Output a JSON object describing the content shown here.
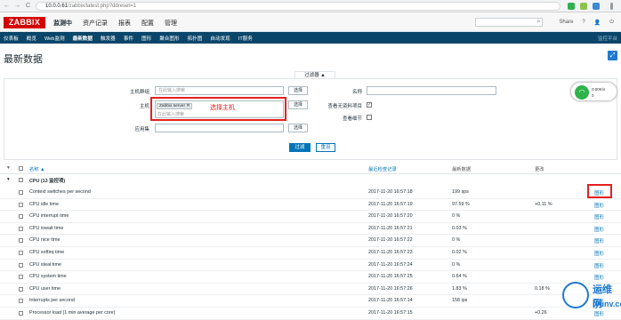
{
  "browser": {
    "back": "←",
    "forward": "→",
    "reload": "C",
    "url_host": "10.0.0.61",
    "url_path": "/zabbix/latest.php?ddreset=1"
  },
  "header": {
    "logo": "ZABBIX",
    "menu": [
      "监测中",
      "资产记录",
      "报表",
      "配置",
      "管理"
    ],
    "right": {
      "share": "Share",
      "help": "?",
      "user": "👤",
      "logout": "⏻"
    }
  },
  "subnav": {
    "items": [
      "仪表板",
      "概览",
      "Web监测",
      "最新数据",
      "触发器",
      "事件",
      "图形",
      "聚合图形",
      "拓扑图",
      "自动发现",
      "IT服务"
    ],
    "right": "监控平台"
  },
  "page": {
    "title": "最新数据"
  },
  "filter": {
    "tab_label": "过滤器 ▲",
    "host_group_label": "主机群组",
    "host_group_placeholder": "在此输入搜索",
    "host_label": "主机",
    "host_tag": "Zabbix server",
    "host_placeholder": "在此输入搜索",
    "app_label": "应用集",
    "select": "选择",
    "name_label": "名称",
    "show_no_data_label": "查看无资料项目",
    "show_details_label": "查看细节",
    "annotation": "选择主机",
    "apply": "过滤",
    "reset": "重设"
  },
  "widget": {
    "line1": "0.00K/s",
    "line2": "0"
  },
  "table": {
    "headers": {
      "name": "名称 ▲",
      "last_check": "最近检查记录",
      "last_value": "最新数据",
      "change": "更改"
    },
    "group": "CPU (13 监控项)",
    "graph_label": "图形",
    "rows": [
      {
        "name": "Context switches per second",
        "time": "2017-11-20 16:57:18",
        "value": "199 sps",
        "change": ""
      },
      {
        "name": "CPU idle time",
        "time": "2017-11-20 16:57:19",
        "value": "97.59 %",
        "change": "+0.11 %"
      },
      {
        "name": "CPU interrupt time",
        "time": "2017-11-20 16:57:20",
        "value": "0 %",
        "change": ""
      },
      {
        "name": "CPU iowait time",
        "time": "2017-11-20 16:57:21",
        "value": "0.03 %",
        "change": ""
      },
      {
        "name": "CPU nice time",
        "time": "2017-11-20 16:57:22",
        "value": "0 %",
        "change": ""
      },
      {
        "name": "CPU softirq time",
        "time": "2017-11-20 16:57:23",
        "value": "0.02 %",
        "change": ""
      },
      {
        "name": "CPU steal time",
        "time": "2017-11-20 16:57:24",
        "value": "0 %",
        "change": ""
      },
      {
        "name": "CPU system time",
        "time": "2017-11-20 16:57:25",
        "value": "0.64 %",
        "change": ""
      },
      {
        "name": "CPU user time",
        "time": "2017-11-20 16:57:26",
        "value": "1.83 %",
        "change": "0.18 %"
      },
      {
        "name": "Interrupts per second",
        "time": "2017-11-20 16:57:14",
        "value": "158 ips",
        "change": ""
      },
      {
        "name": "Processor load (1 min average per core)",
        "time": "2017-11-20 16:57:15",
        "value": "",
        "change": "+0.26"
      }
    ]
  },
  "watermark": {
    "line1": "运维网",
    "line2": "iyunv.com"
  },
  "colors": {
    "brand": "#d40000",
    "nav": "#0a466a",
    "link": "#0275b8",
    "annotation": "#e32020"
  }
}
